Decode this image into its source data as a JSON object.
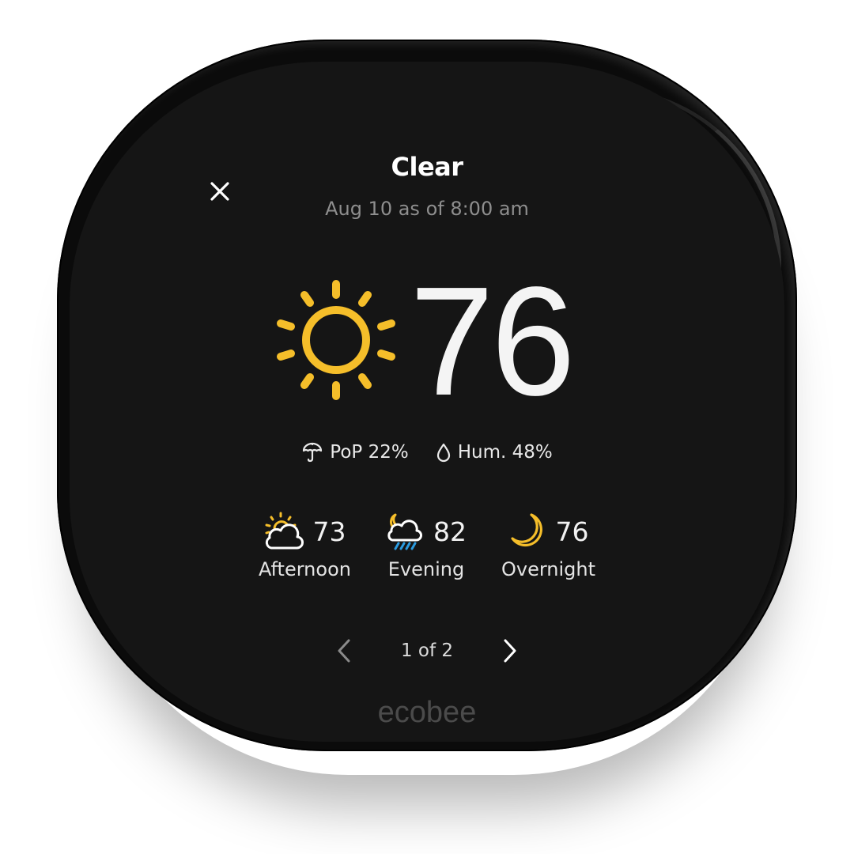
{
  "device": {
    "brand": "ecobee"
  },
  "header": {
    "close_icon": "close-icon",
    "title": "Clear",
    "subtitle": "Aug 10 as of 8:00 am"
  },
  "current": {
    "condition_icon": "sun-icon",
    "temperature": "76",
    "pop_icon": "umbrella-icon",
    "pop_label": "PoP 22%",
    "humidity_icon": "droplet-icon",
    "humidity_label": "Hum. 48%"
  },
  "forecast": [
    {
      "icon": "partly-sunny-cloud-icon",
      "temp": "73",
      "label": "Afternoon"
    },
    {
      "icon": "moon-cloud-rain-icon",
      "temp": "82",
      "label": "Evening"
    },
    {
      "icon": "moon-icon",
      "temp": "76",
      "label": "Overnight"
    }
  ],
  "pager": {
    "prev_icon": "chevron-left-icon",
    "text": "1 of 2",
    "next_icon": "chevron-right-icon"
  },
  "colors": {
    "screen_bg": "#151515",
    "accent_yellow": "#F5BE2A",
    "rain_blue": "#2B9BE0",
    "text_primary": "#FFFFFF",
    "text_secondary": "#8E8E8E",
    "brand_gray": "#4B4B4B"
  }
}
